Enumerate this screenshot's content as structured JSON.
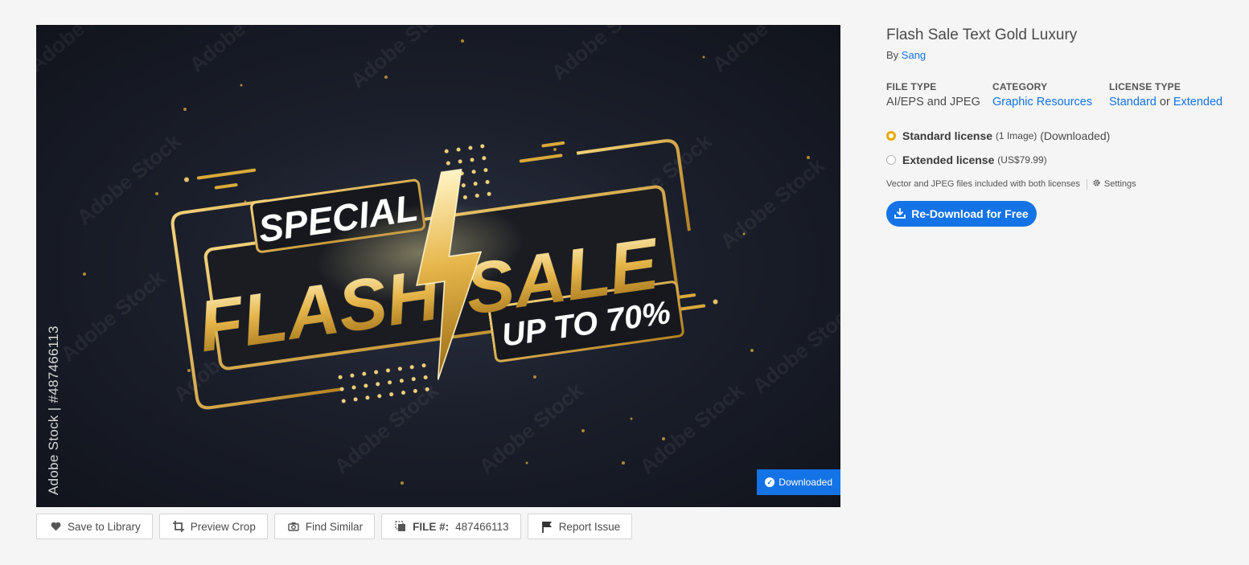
{
  "preview": {
    "vertical_credit": "Adobe Stock | #487466113",
    "watermark": "Adobe Stock",
    "art_text": {
      "special": "SPECIAL",
      "flash": "FLASH",
      "sale": "SALE",
      "offer": "UP TO 70%"
    },
    "downloaded_badge": "Downloaded"
  },
  "toolbar": {
    "save_to_library": "Save to Library",
    "preview_crop": "Preview Crop",
    "find_similar": "Find Similar",
    "file_label": "FILE #:",
    "file_number": "487466113",
    "report_issue": "Report Issue"
  },
  "asset": {
    "title": "Flash Sale Text Gold Luxury",
    "by_prefix": "By",
    "author": "Sang"
  },
  "meta": {
    "file_type_label": "FILE TYPE",
    "file_type_value": "AI/EPS and JPEG",
    "category_label": "CATEGORY",
    "category_value": "Graphic Resources",
    "license_type_label": "LICENSE TYPE",
    "license_standard": "Standard",
    "license_or": "or",
    "license_extended": "Extended"
  },
  "licenses": {
    "standard_name": "Standard license",
    "standard_qty": "(1 Image)",
    "standard_status": "(Downloaded)",
    "extended_name": "Extended license",
    "extended_price": "(US$79.99)",
    "selected": "standard"
  },
  "note": {
    "text": "Vector and JPEG files included with both licenses",
    "settings": "Settings"
  },
  "download_button": "Re-Download for Free",
  "colors": {
    "accent_blue": "#1473e6",
    "radio_selected": "#e8a800",
    "gold": "#d9a93a"
  }
}
